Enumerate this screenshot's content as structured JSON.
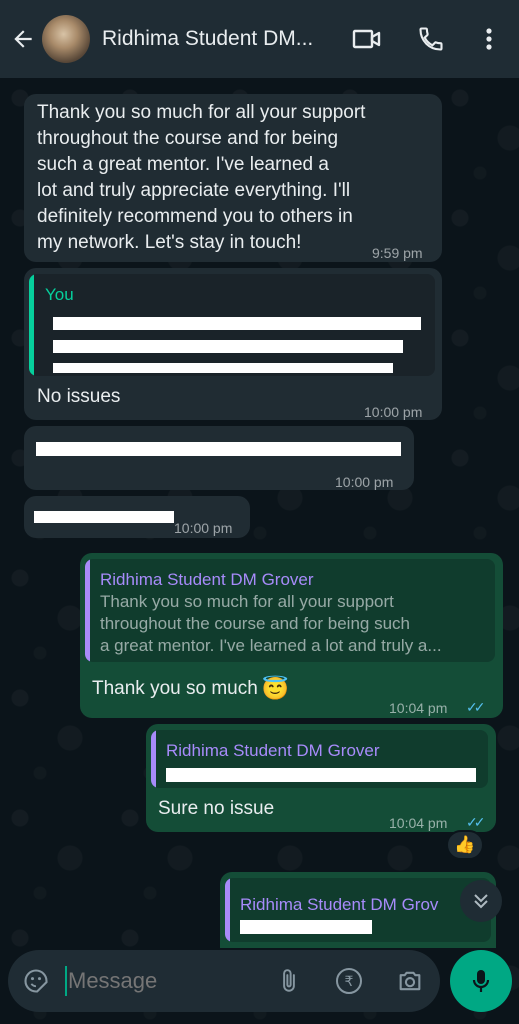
{
  "header": {
    "contact_name": "Ridhima Student DM...",
    "icons": [
      "back-arrow-icon",
      "video-call-icon",
      "phone-call-icon",
      "more-options-icon"
    ]
  },
  "messages": [
    {
      "direction": "incoming",
      "text_lines": [
        "Thank you so much for all your support",
        "throughout the course and for being",
        "such a great mentor. I've learned a",
        "lot and truly appreciate everything. I'll",
        "definitely recommend you to others in",
        "my network. Let's stay in touch!"
      ],
      "time": "9:59 pm"
    },
    {
      "direction": "incoming",
      "quote_name": "You",
      "quote_redacted": true,
      "text": "No issues",
      "time": "10:00 pm"
    },
    {
      "direction": "incoming",
      "text_redacted": true,
      "time": "10:00 pm"
    },
    {
      "direction": "incoming",
      "text_redacted": true,
      "time": "10:00 pm"
    },
    {
      "direction": "outgoing",
      "quote_name": "Ridhima Student DM Grover",
      "quote_lines": [
        "Thank you so much for all your support",
        "throughout the course and for being such",
        "a great mentor. I've learned a lot and truly a..."
      ],
      "text": "Thank you so much",
      "emoji": "😇",
      "time": "10:04 pm",
      "status": "read"
    },
    {
      "direction": "outgoing",
      "quote_name": "Ridhima Student DM Grover",
      "quote_redacted": true,
      "text": "Sure no issue",
      "time": "10:04 pm",
      "status": "read",
      "reaction": "👍"
    },
    {
      "direction": "outgoing",
      "quote_name": "Ridhima Student DM Grov",
      "quote_redacted": true
    }
  ],
  "composer": {
    "placeholder": "Message",
    "icons": [
      "sticker-icon",
      "attach-icon",
      "rupee-payment-icon",
      "camera-icon",
      "mic-icon"
    ]
  },
  "colors": {
    "background": "#0b141a",
    "header": "#1f2c34",
    "incoming_bubble": "#202c33",
    "outgoing_bubble": "#144d37",
    "accent_green": "#00a884",
    "quote_you": "#06cf9c",
    "quote_other": "#a78bfa",
    "read_ticks": "#53bdeb"
  }
}
